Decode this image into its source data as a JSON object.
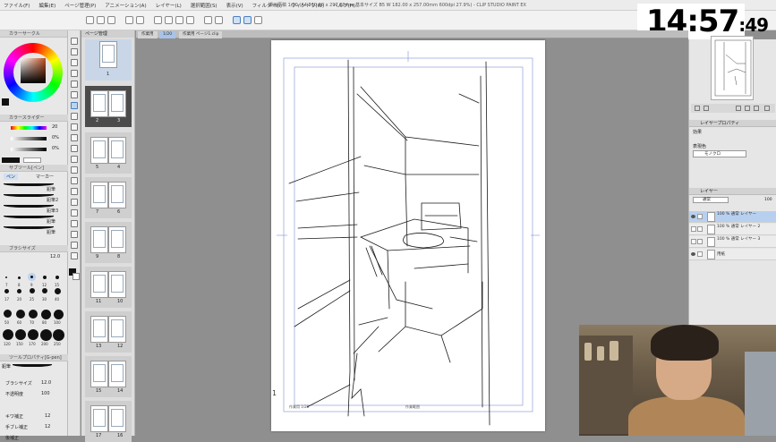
{
  "menubar": {
    "items": [
      "ファイル(F)",
      "編集(E)",
      "ページ管理(P)",
      "アニメーション(A)",
      "レイヤー(L)",
      "選択範囲(S)",
      "表示(V)",
      "フィルター(I)",
      "ウィンドウ(W)",
      "ヘルプ(H)"
    ],
    "title": "漫画原稿 1/20 (A4 210.00 x 297.00mm 基本サイズ B5 W 182.00 x 257.00mm 600dpi 27.9%) - CLIP STUDIO PAINT EX"
  },
  "clock": {
    "hm": "14:57",
    "sec": ":49"
  },
  "left": {
    "color_panel_title": "カラーサークル",
    "slider_panel_title": "カラースライダー",
    "slider_values": [
      "20",
      "0%",
      "0%"
    ],
    "subtool_title": "サブツール[ペン]",
    "subtool_tabs": [
      "ペン",
      "マーカー"
    ],
    "brushes": [
      "鉛筆",
      "鉛筆2",
      "鉛筆3",
      "鉛筆",
      "鉛筆"
    ],
    "brushsize_title": "ブラシサイズ",
    "brushsize_value": "12.0",
    "sizes": [
      "7",
      "8",
      "9",
      "12",
      "15",
      "17",
      "20",
      "25",
      "30",
      "40",
      "50",
      "60",
      "70",
      "80",
      "100",
      "120",
      "150",
      "170",
      "200",
      "250"
    ],
    "tool_property_title": "ツールプロパティ[G-pen]",
    "tool_props": [
      {
        "label": "鉛筆",
        "value": ""
      },
      {
        "label": "ブラシサイズ",
        "value": "12.0"
      },
      {
        "label": "不透明度",
        "value": "100"
      },
      {
        "label": "キワ補正",
        "value": "12"
      },
      {
        "label": "手ブレ補正",
        "value": "12"
      },
      {
        "label": "後補正",
        "value": ""
      }
    ]
  },
  "pages": {
    "tabs": [
      "ページ管理",
      "作業用"
    ],
    "thumbs": [
      {
        "left": "",
        "right": "1"
      },
      {
        "left": "2",
        "right": "3"
      },
      {
        "left": "5",
        "right": "4"
      },
      {
        "left": "7",
        "right": "6"
      },
      {
        "left": "9",
        "right": "8"
      },
      {
        "left": "11",
        "right": "10"
      },
      {
        "left": "13",
        "right": "12"
      },
      {
        "left": "15",
        "right": "14"
      },
      {
        "left": "17",
        "right": "16"
      }
    ]
  },
  "canvas": {
    "tabs": [
      "作業用",
      "1/20",
      "作業用 ページ1.clip"
    ],
    "page_number": "1",
    "footer_left": "作業用 1/20",
    "footer_mid": "作業範囲"
  },
  "right": {
    "layer_property_title": "レイヤープロパティ",
    "effect_label": "効果",
    "display_color_label": "表現色",
    "display_color_value": "モノクロ",
    "layer_title": "レイヤー",
    "blend_mode": "通常",
    "opacity": "100",
    "layers": [
      {
        "name": "100 % 通常\nレイヤー",
        "selected": true
      },
      {
        "name": "100 % 通常\nレイヤー 2",
        "selected": false
      },
      {
        "name": "100 % 通常\nレイヤー 3",
        "selected": false
      },
      {
        "name": "用紙",
        "selected": false
      }
    ]
  },
  "colors": {
    "accent": "#4a7fc0",
    "selection": "#b7d0ef"
  }
}
